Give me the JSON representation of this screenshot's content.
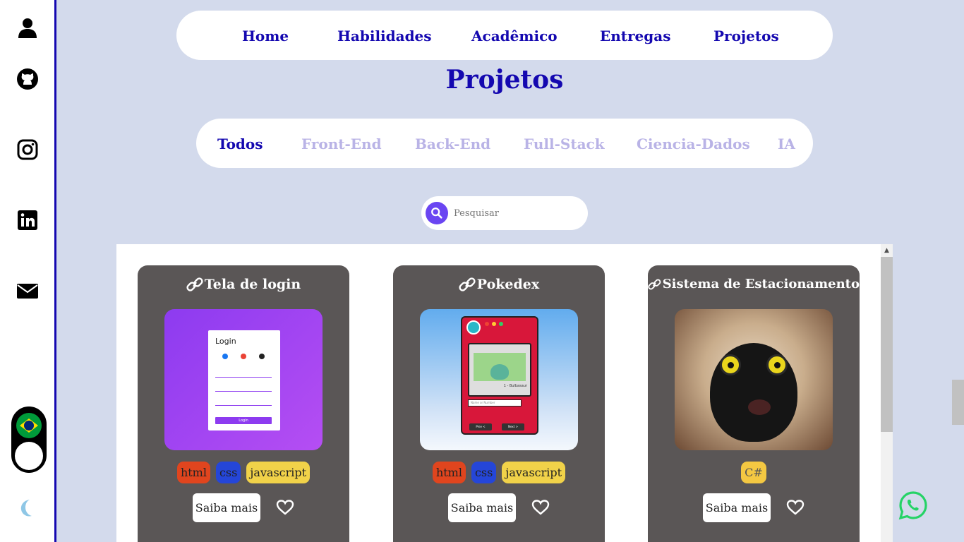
{
  "nav": {
    "items": [
      "Home",
      "Habilidades",
      "Acadêmico",
      "Entregas",
      "Projetos"
    ]
  },
  "page_title": "Projetos",
  "filters": {
    "items": [
      "Todos",
      "Front-End",
      "Back-End",
      "Full-Stack",
      "Ciencia-Dados",
      "IA"
    ],
    "active": "Todos"
  },
  "search": {
    "placeholder": "Pesquisar"
  },
  "sidebar": {
    "icons": [
      "user-icon",
      "github-icon",
      "instagram-icon",
      "linkedin-icon",
      "mail-icon"
    ],
    "language": "brazil-flag-icon",
    "theme": "moon-icon"
  },
  "projects": [
    {
      "title": "Tela de login",
      "tags": [
        "html",
        "css",
        "javascript"
      ],
      "button": "Saiba mais",
      "thumb_text": {
        "heading": "Login",
        "button": "Login"
      }
    },
    {
      "title": "Pokedex",
      "tags": [
        "html",
        "css",
        "javascript"
      ],
      "button": "Saiba mais",
      "thumb_text": {
        "name": "1 - Bulbasaur",
        "input": "Name or Number",
        "prev": "Prev <",
        "next": "Next >"
      }
    },
    {
      "title": "Sistema de Estacionamento",
      "tags": [
        "C#"
      ],
      "button": "Saiba mais"
    }
  ],
  "colors": {
    "accent": "#1408b0",
    "background": "#d3daec",
    "card": "#5a5656",
    "tag_html": "#e0451e",
    "tag_css": "#2546d8",
    "tag_js": "#f1d249",
    "tag_cs": "#f4c842",
    "whatsapp": "#25d366"
  }
}
